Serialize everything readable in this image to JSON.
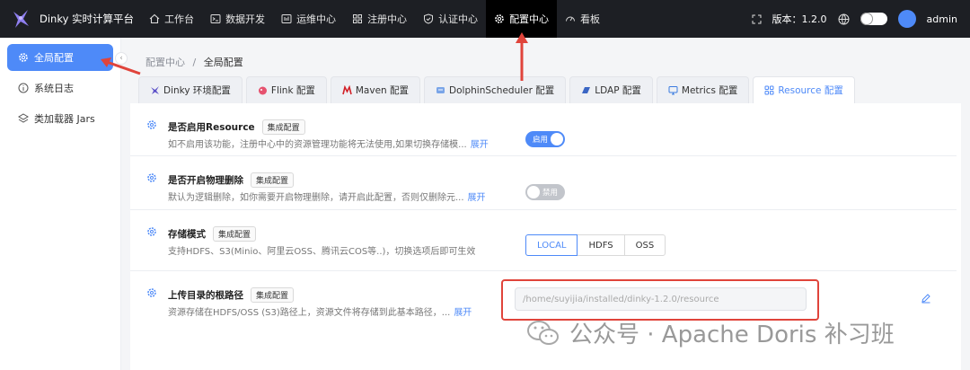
{
  "brand": {
    "title": "Dinky 实时计算平台"
  },
  "nav": {
    "items": [
      {
        "label": "工作台",
        "icon": "home-icon"
      },
      {
        "label": "数据开发",
        "icon": "terminal-icon"
      },
      {
        "label": "运维中心",
        "icon": "monitor-icon"
      },
      {
        "label": "注册中心",
        "icon": "grid-icon"
      },
      {
        "label": "认证中心",
        "icon": "shield-icon"
      },
      {
        "label": "配置中心",
        "icon": "gear-icon",
        "active": true
      },
      {
        "label": "看板",
        "icon": "dashboard-icon"
      }
    ],
    "version": "版本：1.2.0",
    "user": "admin"
  },
  "sidebar": {
    "items": [
      {
        "label": "全局配置",
        "active": true
      },
      {
        "label": "系统日志"
      },
      {
        "label": "类加载器 Jars"
      }
    ]
  },
  "breadcrumb": {
    "parent": "配置中心",
    "sep": "/",
    "current": "全局配置"
  },
  "tabs": [
    {
      "label": "Dinky 环境配置"
    },
    {
      "label": "Flink 配置"
    },
    {
      "label": "Maven 配置"
    },
    {
      "label": "DolphinScheduler 配置"
    },
    {
      "label": "LDAP 配置"
    },
    {
      "label": "Metrics 配置"
    },
    {
      "label": "Resource 配置",
      "active": true
    }
  ],
  "settings": [
    {
      "title": "是否启用Resource",
      "tag": "集成配置",
      "desc": "如不启用该功能，注册中心中的资源管理功能将无法使用,如果切换存储模...",
      "more": "展开",
      "switch_label": "启用",
      "enabled": true
    },
    {
      "title": "是否开启物理删除",
      "tag": "集成配置",
      "desc": "默认为逻辑删除，如你需要开启物理删除，请开启此配置，否则仅删除元...",
      "more": "展开",
      "switch_label": "禁用",
      "enabled": false
    },
    {
      "title": "存储模式",
      "tag": "集成配置",
      "desc": "支持HDFS、S3(Minio、阿里云OSS、腾讯云COS等..)，切换选项后即可生效",
      "options": [
        "LOCAL",
        "HDFS",
        "OSS"
      ],
      "selected": "LOCAL"
    },
    {
      "title": "上传目录的根路径",
      "tag": "集成配置",
      "desc": "资源存储在HDFS/OSS (S3)路径上，资源文件将存储到此基本路径，...",
      "more": "展开",
      "value": "/home/suyijia/installed/dinky-1.2.0/resource"
    }
  ],
  "watermark": "公众号 · Apache Doris 补习班",
  "colors": {
    "accent": "#4e8af8",
    "annotation": "#e0443b",
    "topbar": "#1d1f24"
  }
}
